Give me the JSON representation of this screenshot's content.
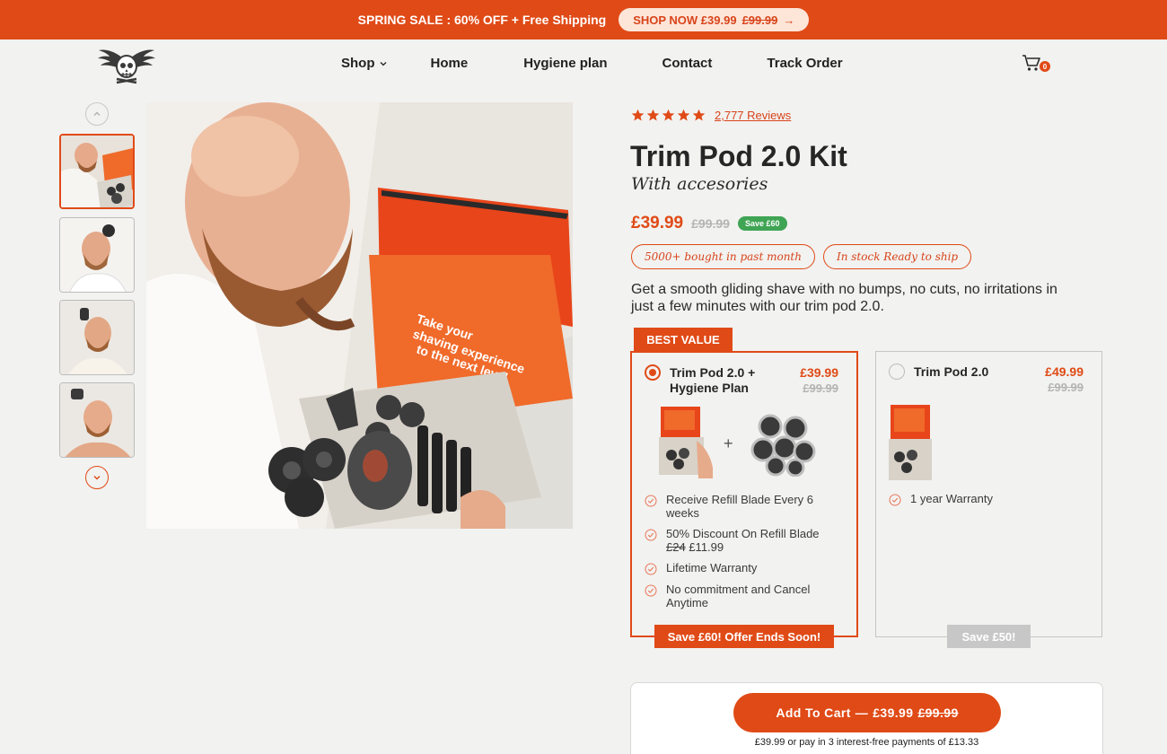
{
  "announcement": {
    "text": "SPRING SALE : 60% OFF + Free Shipping",
    "button_label": "SHOP NOW £39.99",
    "button_old_price": "£99.99",
    "button_arrow": "→"
  },
  "nav": {
    "logo_icon": "skull-wings-logo",
    "items": [
      {
        "label": "Shop",
        "dropdown": true
      },
      {
        "label": "Home"
      },
      {
        "label": "Hygiene plan"
      },
      {
        "label": "Contact"
      },
      {
        "label": "Track Order"
      }
    ],
    "cart_count": "0",
    "cart_icon": "cart-icon"
  },
  "gallery": {
    "active_thumbnail": 0,
    "thumbnail_count": 4,
    "up_icon": "chevron-up-icon",
    "down_icon": "chevron-down-icon"
  },
  "product": {
    "rating_stars": 5,
    "reviews_label": "2,777 Reviews",
    "title": "Trim Pod 2.0 Kit",
    "subtitle": "With accesories",
    "price": "£39.99",
    "old_price": "£99.99",
    "save_badge": "Save £60",
    "pills": [
      "5000+ bought in past month",
      "In stock Ready to ship"
    ],
    "description": "Get a smooth gliding shave with no bumps, no cuts, no irritations in just a few minutes with our trim pod 2.0."
  },
  "offers": {
    "best_value_tag": "BEST VALUE",
    "plus_sign": "+",
    "items": [
      {
        "name": "Trim Pod 2.0 + Hygiene Plan",
        "price": "£39.99",
        "old_price": "£99.99",
        "selected": true,
        "features": [
          {
            "text": "Receive Refill Blade Every 6 weeks"
          },
          {
            "text_strike": "£24",
            "text": "50% Discount On Refill Blade",
            "text_after": "£11.99"
          },
          {
            "text": "Lifetime Warranty"
          },
          {
            "text": "No commitment and Cancel Anytime"
          }
        ],
        "banner": "Save £60! Offer Ends Soon!"
      },
      {
        "name": "Trim Pod 2.0",
        "price": "£49.99",
        "old_price": "£99.99",
        "selected": false,
        "features": [
          {
            "text": "1 year Warranty"
          }
        ],
        "banner": "Save £50!"
      }
    ]
  },
  "cart": {
    "button_label": "Add To Cart",
    "button_separator": "—",
    "button_price": "£39.99",
    "button_old_price": "£99.99",
    "installment_note": "£39.99 or pay in 3 interest-free payments of £13.33"
  },
  "colors": {
    "accent": "#e04a16",
    "success": "#3fa453",
    "background": "#f2f2f0"
  }
}
